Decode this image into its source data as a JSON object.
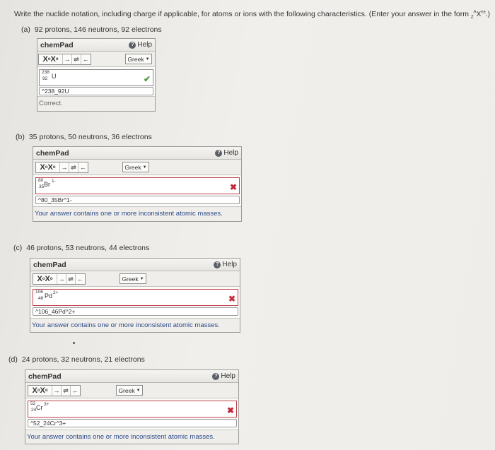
{
  "instructions": {
    "text": "Write the nuclide notation, including charge if applicable, for atoms or ions with the following characteristics. (Enter your answer in the form",
    "form_mass": "A",
    "form_atomic": "Z",
    "form_symbol": "X",
    "form_charge": "n±",
    "form_end": ".)"
  },
  "chempad": {
    "title": "chemPad",
    "help_label": "Help",
    "greek_label": "Greek",
    "tool_xx": "X",
    "tool_arrow": "→",
    "tool_equilibrium": "⇌",
    "tool_back": "←"
  },
  "parts": [
    {
      "letter": "(a)",
      "description": "92 protons, 146 neutrons, 92 electrons",
      "nuclide": {
        "mass": "238",
        "atomic": "92",
        "symbol": "U",
        "charge": ""
      },
      "entry": "^238_92U",
      "status": "correct",
      "feedback": "Correct."
    },
    {
      "letter": "(b)",
      "description": "35 protons, 50 neutrons, 36 electrons",
      "nuclide": {
        "mass": "80",
        "atomic": "35",
        "symbol": "Br",
        "charge": "1-"
      },
      "entry": "^80_35Br^1-",
      "status": "incorrect",
      "feedback": "Your answer contains one or more inconsistent atomic masses."
    },
    {
      "letter": "(c)",
      "description": "46 protons, 53 neutrons, 44 electrons",
      "nuclide": {
        "mass": "106",
        "atomic": "46",
        "symbol": "Pd",
        "charge": "2+"
      },
      "entry": "^106_46Pd^2+",
      "status": "incorrect",
      "feedback": "Your answer contains one or more inconsistent atomic masses."
    },
    {
      "letter": "(d)",
      "description": "24 protons, 32 neutrons, 21 electrons",
      "nuclide": {
        "mass": "52",
        "atomic": "24",
        "symbol": "Cr",
        "charge": "3+"
      },
      "entry": "^52_24Cr^3+",
      "status": "incorrect",
      "feedback": "Your answer contains one or more inconsistent atomic masses."
    }
  ],
  "colors": {
    "correct_mark": "#4a9e3a",
    "incorrect_mark": "#c6283a",
    "error_feedback": "#2d4a8a"
  },
  "icons": {
    "correct": "checkmark-icon",
    "incorrect": "x-mark-icon",
    "help": "help-circle-icon",
    "dropdown": "caret-down-icon"
  }
}
